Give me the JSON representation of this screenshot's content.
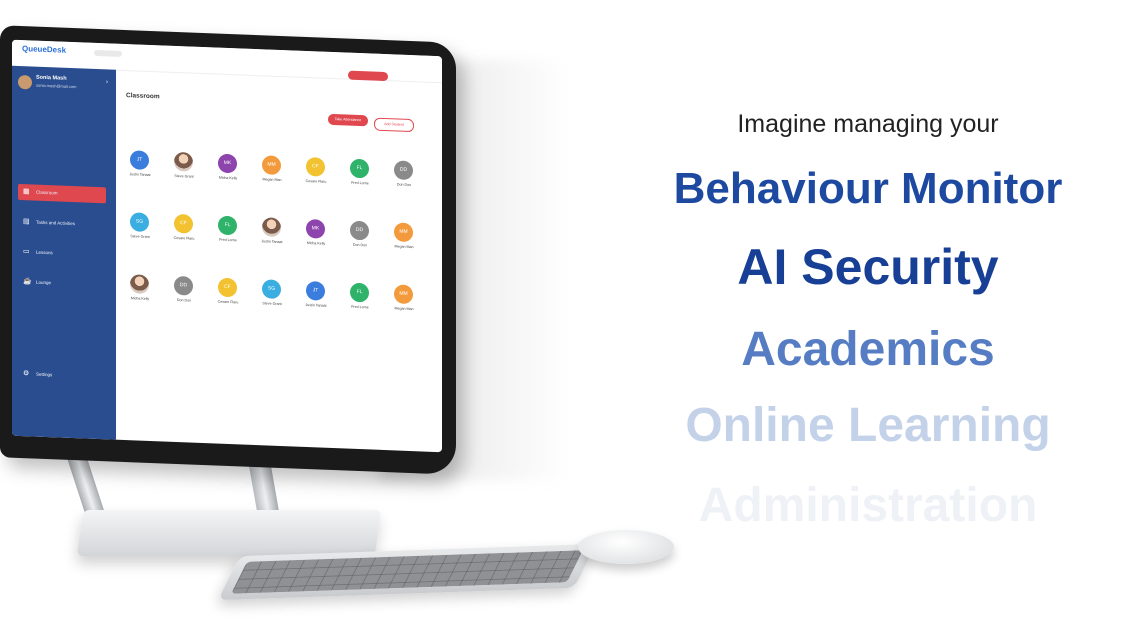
{
  "headline": "Imagine managing your",
  "features": [
    "Behaviour Monitor",
    "AI Security",
    "Academics",
    "Online Learning",
    "Administration"
  ],
  "app": {
    "logo": "QueueDesk",
    "profile": {
      "name": "Sonia Mash",
      "email": "sonia.mash@mail.com"
    },
    "sidebar": {
      "items": [
        {
          "label": "Classroom",
          "icon": "grid-icon"
        },
        {
          "label": "Tasks and Activities",
          "icon": "clipboard-icon"
        },
        {
          "label": "Lessons",
          "icon": "monitor-icon"
        },
        {
          "label": "Lounge",
          "icon": "coffee-icon"
        }
      ],
      "settings": "Settings"
    },
    "main": {
      "title": "Classroom",
      "take_attendance": "Take Attendance",
      "add_student": "Add Student"
    },
    "students": [
      {
        "initials": "JT",
        "name": "Justin Tanaat",
        "color": "#3b7ddd"
      },
      {
        "initials": "",
        "name": "Steve Grant",
        "color": "photo"
      },
      {
        "initials": "MK",
        "name": "Micha Kelly",
        "color": "#8e44ad"
      },
      {
        "initials": "MM",
        "name": "Megan Man",
        "color": "#f39a3c"
      },
      {
        "initials": "CF",
        "name": "Cesare Flaru",
        "color": "#f2c230"
      },
      {
        "initials": "FL",
        "name": "Fred Lorne",
        "color": "#2fb36b"
      },
      {
        "initials": "DD",
        "name": "Don Don",
        "color": "#8a8a8a"
      },
      {
        "initials": "SG",
        "name": "Steve Grant",
        "color": "#3aaee0"
      },
      {
        "initials": "CF",
        "name": "Cesare Flaru",
        "color": "#f2c230"
      },
      {
        "initials": "FL",
        "name": "Fred Lorne",
        "color": "#2fb36b"
      },
      {
        "initials": "",
        "name": "Justin Tanaat",
        "color": "photo"
      },
      {
        "initials": "MK",
        "name": "Micha Kelly",
        "color": "#8e44ad"
      },
      {
        "initials": "DD",
        "name": "Don Don",
        "color": "#8a8a8a"
      },
      {
        "initials": "MM",
        "name": "Megan Man",
        "color": "#f39a3c"
      },
      {
        "initials": "",
        "name": "Micha Kelly",
        "color": "photo"
      },
      {
        "initials": "DD",
        "name": "Don Don",
        "color": "#8a8a8a"
      },
      {
        "initials": "CF",
        "name": "Cesare Flaru",
        "color": "#f2c230"
      },
      {
        "initials": "SG",
        "name": "Steve Grant",
        "color": "#3aaee0"
      },
      {
        "initials": "JT",
        "name": "Justin Tanaat",
        "color": "#3b7ddd"
      },
      {
        "initials": "FL",
        "name": "Fred Lorne",
        "color": "#2fb36b"
      },
      {
        "initials": "MM",
        "name": "Megan Man",
        "color": "#f39a3c"
      }
    ]
  }
}
